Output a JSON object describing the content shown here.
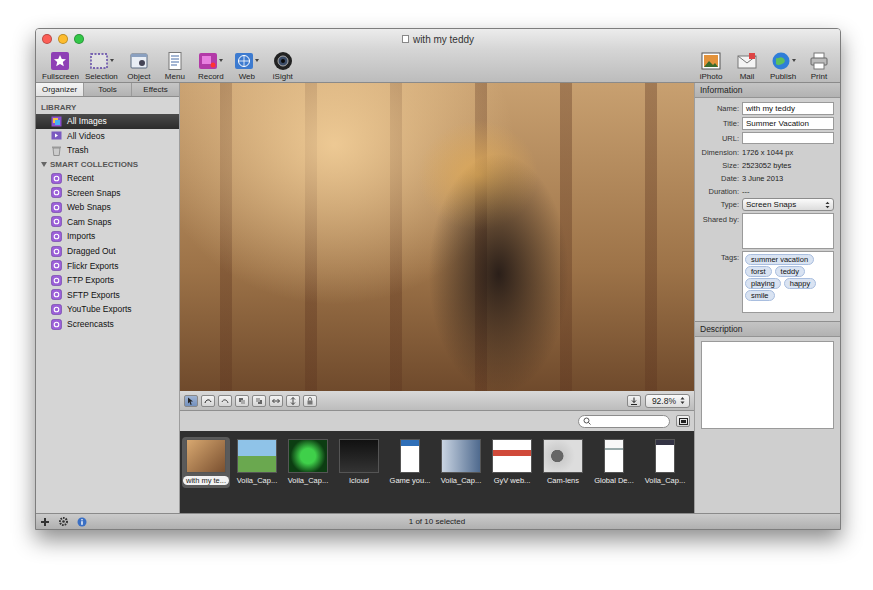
{
  "window": {
    "title": "with my teddy"
  },
  "toolbar": {
    "left": [
      {
        "label": "Fullscreen",
        "dropdown": false
      },
      {
        "label": "Selection",
        "dropdown": true
      },
      {
        "label": "Object",
        "dropdown": false
      },
      {
        "label": "Menu",
        "dropdown": false
      },
      {
        "label": "Record",
        "dropdown": true
      },
      {
        "label": "Web",
        "dropdown": true
      },
      {
        "label": "iSight",
        "dropdown": false
      }
    ],
    "right": [
      {
        "label": "iPhoto",
        "dropdown": false
      },
      {
        "label": "Mail",
        "dropdown": false
      },
      {
        "label": "Publish",
        "dropdown": true
      },
      {
        "label": "Print",
        "dropdown": false
      }
    ]
  },
  "sidebar": {
    "tabs": [
      {
        "label": "Organizer",
        "selected": true
      },
      {
        "label": "Tools",
        "selected": false
      },
      {
        "label": "Effects",
        "selected": false
      }
    ],
    "sections": [
      {
        "title": "LIBRARY",
        "collapsible": false,
        "expanded": true,
        "items": [
          {
            "label": "All Images",
            "selected": true
          },
          {
            "label": "All Videos",
            "selected": false
          },
          {
            "label": "Trash",
            "selected": false
          }
        ]
      },
      {
        "title": "SMART COLLECTIONS",
        "collapsible": true,
        "expanded": true,
        "items": [
          {
            "label": "Recent",
            "selected": false
          },
          {
            "label": "Screen Snaps",
            "selected": false
          },
          {
            "label": "Web Snaps",
            "selected": false
          },
          {
            "label": "Cam Snaps",
            "selected": false
          },
          {
            "label": "Imports",
            "selected": false
          },
          {
            "label": "Dragged Out",
            "selected": false
          },
          {
            "label": "Flickr Exports",
            "selected": false
          },
          {
            "label": "FTP Exports",
            "selected": false
          },
          {
            "label": "SFTP Exports",
            "selected": false
          },
          {
            "label": "YouTube Exports",
            "selected": false
          },
          {
            "label": "Screencasts",
            "selected": false
          }
        ]
      }
    ]
  },
  "editor": {
    "tools": [
      {
        "selected": true
      },
      {
        "selected": false
      },
      {
        "selected": false
      },
      {
        "selected": false
      },
      {
        "selected": false
      },
      {
        "selected": false
      },
      {
        "selected": false
      },
      {
        "selected": false
      }
    ],
    "zoom": "92.8%"
  },
  "browser": {
    "thumbnails": [
      {
        "label": "with my te...",
        "selected": true
      },
      {
        "label": "Voila_Cap...",
        "selected": false
      },
      {
        "label": "Voila_Cap...",
        "selected": false
      },
      {
        "label": "Icloud",
        "selected": false
      },
      {
        "label": "Game you...",
        "selected": false
      },
      {
        "label": "Voila_Cap...",
        "selected": false
      },
      {
        "label": "GyV web...",
        "selected": false
      },
      {
        "label": "Cam-lens",
        "selected": false
      },
      {
        "label": "Global De...",
        "selected": false
      },
      {
        "label": "Voila_Cap...",
        "selected": false
      }
    ]
  },
  "status_bar": {
    "text": "1 of 10 selected"
  },
  "info": {
    "header": "Information",
    "fields": [
      {
        "label": "Name:",
        "kind": "input",
        "value": "with my teddy"
      },
      {
        "label": "Title:",
        "kind": "input",
        "value": "Summer Vacation"
      },
      {
        "label": "URL:",
        "kind": "input",
        "value": ""
      },
      {
        "label": "Dimension:",
        "kind": "text",
        "value": "1726 x 1044 px"
      },
      {
        "label": "Size:",
        "kind": "text",
        "value": "2523052 bytes"
      },
      {
        "label": "Date:",
        "kind": "text",
        "value": "3 June 2013"
      },
      {
        "label": "Duration:",
        "kind": "text",
        "value": "---"
      },
      {
        "label": "Type:",
        "kind": "select",
        "value": "Screen Snaps"
      },
      {
        "label": "Shared by:",
        "kind": "box",
        "value": ""
      },
      {
        "label": "Tags:",
        "kind": "tags",
        "value": "",
        "tags": [
          "summer vacation",
          "forst",
          "teddy",
          "playing",
          "happy",
          "smile"
        ]
      }
    ],
    "description": {
      "label": "Description"
    }
  }
}
